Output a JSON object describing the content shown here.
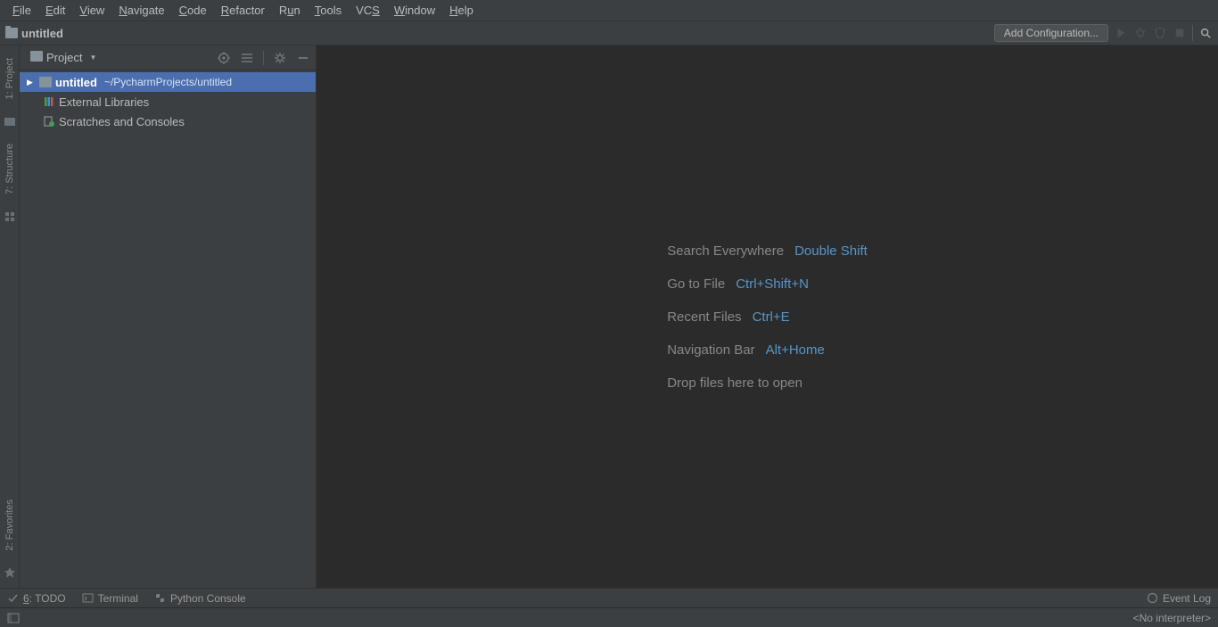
{
  "menubar": [
    {
      "label": "File",
      "mn": "F",
      "rest": "ile"
    },
    {
      "label": "Edit",
      "mn": "E",
      "rest": "dit"
    },
    {
      "label": "View",
      "mn": "V",
      "rest": "iew"
    },
    {
      "label": "Navigate",
      "mn": "N",
      "rest": "avigate"
    },
    {
      "label": "Code",
      "mn": "C",
      "rest": "ode"
    },
    {
      "label": "Refactor",
      "mn": "R",
      "rest": "efactor"
    },
    {
      "label": "Run",
      "mn": "",
      "rest": "Run",
      "mn2": "u",
      "pre": "R",
      "post": "n"
    },
    {
      "label": "Tools",
      "mn": "T",
      "rest": "ools"
    },
    {
      "label": "VCS",
      "mn": "",
      "pre": "VC",
      "mn2": "S",
      "post": ""
    },
    {
      "label": "Window",
      "mn": "W",
      "rest": "indow"
    },
    {
      "label": "Help",
      "mn": "H",
      "rest": "elp"
    }
  ],
  "navbar": {
    "project": "untitled",
    "add_config": "Add Configuration..."
  },
  "gutter": {
    "top": [
      {
        "label": "1: Project"
      },
      {
        "label": "7: Structure"
      }
    ],
    "bottom": [
      {
        "label": "2: Favorites"
      }
    ]
  },
  "project_panel": {
    "title": "Project",
    "tree": {
      "root": {
        "name": "untitled",
        "path": "~/PycharmProjects/untitled"
      },
      "external": "External Libraries",
      "scratches": "Scratches and Consoles"
    }
  },
  "editor_hints": [
    {
      "label": "Search Everywhere",
      "shortcut": "Double Shift"
    },
    {
      "label": "Go to File",
      "shortcut": "Ctrl+Shift+N"
    },
    {
      "label": "Recent Files",
      "shortcut": "Ctrl+E"
    },
    {
      "label": "Navigation Bar",
      "shortcut": "Alt+Home"
    },
    {
      "label": "Drop files here to open",
      "shortcut": ""
    }
  ],
  "bottom_bar": {
    "todo": {
      "num": "6",
      "label": ": TODO"
    },
    "terminal": "Terminal",
    "python_console": "Python Console",
    "event_log": "Event Log"
  },
  "status_bar": {
    "interpreter": "<No interpreter>"
  }
}
